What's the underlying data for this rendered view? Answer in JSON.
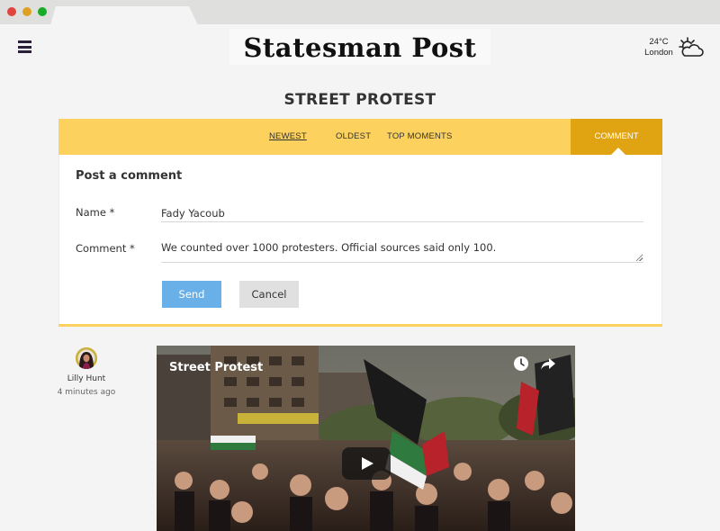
{
  "header": {
    "logo": "Statesman Post",
    "weather": {
      "temperature": "24°C",
      "city": "London",
      "icon": "partly-cloudy-icon"
    }
  },
  "page": {
    "title": "STREET PROTEST"
  },
  "nav": {
    "tabs": [
      {
        "label": "NEWEST"
      },
      {
        "label": "OLDEST"
      },
      {
        "label": "TOP MOMENTS"
      }
    ],
    "comment_button": "COMMENT"
  },
  "form": {
    "title": "Post a comment",
    "name_label": "Name *",
    "name_value": "Fady Yacoub",
    "comment_label": "Comment *",
    "comment_value": "We counted over 1000 protesters. Official sources said only 100.",
    "send_label": "Send",
    "cancel_label": "Cancel"
  },
  "post": {
    "author": "Lilly Hunt",
    "time": "4 minutes ago",
    "video": {
      "title": "Street Protest"
    }
  },
  "colors": {
    "nav_bar": "#fcd15e",
    "comment_tab": "#e0a412",
    "send_button": "#69b0e8",
    "cancel_button": "#e0e0e0"
  }
}
